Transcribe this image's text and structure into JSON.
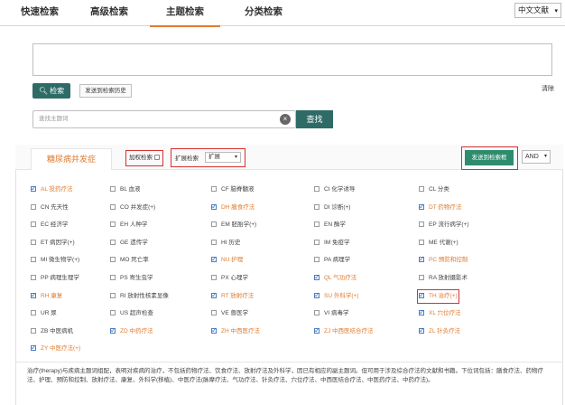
{
  "tabs": [
    {
      "label": "快速检索",
      "active": false
    },
    {
      "label": "高级检索",
      "active": false
    },
    {
      "label": "主题检索",
      "active": true
    },
    {
      "label": "分类检索",
      "active": false
    }
  ],
  "language": {
    "value": "中文文献"
  },
  "toolbar": {
    "search_label": "检索",
    "history_label": "发送到检索历史",
    "clear_label": "清除"
  },
  "subject": {
    "placeholder": "查找主题词",
    "button_label": "查找"
  },
  "panel": {
    "tab_label": "糖尿病并发症",
    "add_weight_label": "加权检索",
    "expand_label": "扩展检索",
    "expand_value": "扩展",
    "send_label": "发送到检索框",
    "logic_value": "AND"
  },
  "qualifiers": [
    {
      "code": "AL",
      "name": "投药疗法",
      "checked": true
    },
    {
      "code": "BL",
      "name": "血液",
      "checked": false
    },
    {
      "code": "CF",
      "name": "脑脊髓液",
      "checked": false
    },
    {
      "code": "CI",
      "name": "化学诱导",
      "checked": false
    },
    {
      "code": "CL",
      "name": "分类",
      "checked": false
    },
    {
      "code": "CN",
      "name": "先天性",
      "checked": false
    },
    {
      "code": "CO",
      "name": "并发症(+)",
      "checked": false
    },
    {
      "code": "DH",
      "name": "膳食疗法",
      "checked": true
    },
    {
      "code": "DI",
      "name": "诊断(+)",
      "checked": false
    },
    {
      "code": "DT",
      "name": "药物疗法",
      "checked": true
    },
    {
      "code": "EC",
      "name": "经济学",
      "checked": false
    },
    {
      "code": "EH",
      "name": "人种学",
      "checked": false
    },
    {
      "code": "EM",
      "name": "胚胎学(+)",
      "checked": false
    },
    {
      "code": "EN",
      "name": "酶学",
      "checked": false
    },
    {
      "code": "EP",
      "name": "流行病学(+)",
      "checked": false
    },
    {
      "code": "ET",
      "name": "病因学(+)",
      "checked": false
    },
    {
      "code": "GE",
      "name": "遗传学",
      "checked": false
    },
    {
      "code": "HI",
      "name": "历史",
      "checked": false
    },
    {
      "code": "IM",
      "name": "免疫学",
      "checked": false
    },
    {
      "code": "ME",
      "name": "代谢(+)",
      "checked": false
    },
    {
      "code": "MI",
      "name": "微生物学(+)",
      "checked": false
    },
    {
      "code": "MO",
      "name": "死亡率",
      "checked": false
    },
    {
      "code": "NU",
      "name": "护理",
      "checked": true
    },
    {
      "code": "PA",
      "name": "病理学",
      "checked": false
    },
    {
      "code": "PC",
      "name": "预防和控制",
      "checked": true
    },
    {
      "code": "PP",
      "name": "病理生理学",
      "checked": false
    },
    {
      "code": "PS",
      "name": "寄生虫学",
      "checked": false
    },
    {
      "code": "PX",
      "name": "心理学",
      "checked": false
    },
    {
      "code": "QL",
      "name": "气功疗法",
      "checked": true
    },
    {
      "code": "RA",
      "name": "放射摄影术",
      "checked": false
    },
    {
      "code": "RH",
      "name": "康复",
      "checked": true
    },
    {
      "code": "RI",
      "name": "放射性核素显像",
      "checked": false
    },
    {
      "code": "RT",
      "name": "放射疗法",
      "checked": true
    },
    {
      "code": "SU",
      "name": "外科学(+)",
      "checked": true
    },
    {
      "code": "TH",
      "name": "治疗(+)",
      "checked": true
    },
    {
      "code": "UR",
      "name": "尿",
      "checked": false
    },
    {
      "code": "US",
      "name": "超声检查",
      "checked": false
    },
    {
      "code": "VE",
      "name": "兽医学",
      "checked": false
    },
    {
      "code": "VI",
      "name": "病毒学",
      "checked": false
    },
    {
      "code": "XL",
      "name": "穴位疗法",
      "checked": true
    },
    {
      "code": "ZB",
      "name": "中医病机",
      "checked": false
    },
    {
      "code": "ZD",
      "name": "中药疗法",
      "checked": true
    },
    {
      "code": "ZH",
      "name": "中西医疗法",
      "checked": true
    },
    {
      "code": "ZJ",
      "name": "中西医结合疗法",
      "checked": true
    },
    {
      "code": "ZL",
      "name": "针灸疗法",
      "checked": true
    },
    {
      "code": "ZY",
      "name": "中医疗法(+)",
      "checked": true
    }
  ],
  "description": "治疗(therapy)与疾病主题词组配，表明对疾病的治疗，不包括药物疗法、饮食疗法、放射疗法及外科学，因已有相应的副主题词。但可用于涉及综合疗法的文献和书籍。下位词包括：膳食疗法、药物疗法、护理、预防和控制、放射疗法、康复、外科学(移植)、中医疗法(脉摩疗法、气功疗法、针灸疗法、穴位疗法、中西医结合疗法、中医药疗法、中药疗法)。"
}
